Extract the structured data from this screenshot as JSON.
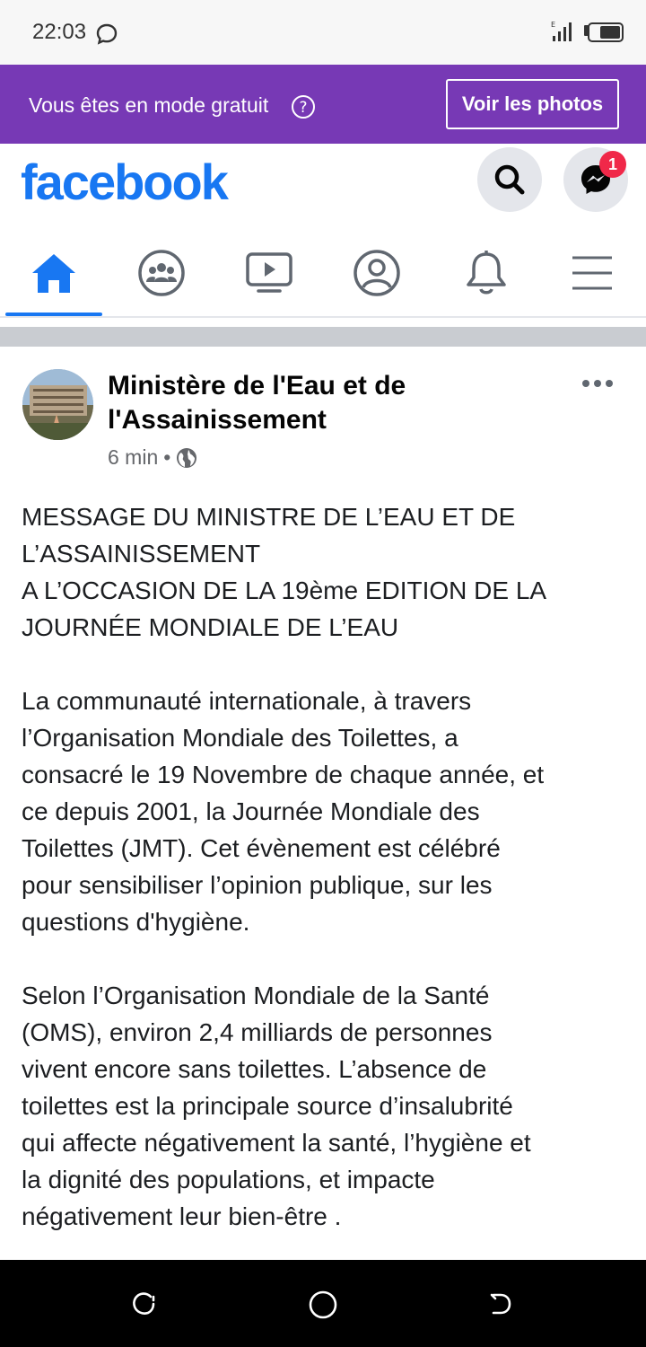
{
  "status_bar": {
    "time": "22:03"
  },
  "banner": {
    "free_mode_text": "Vous êtes en mode gratuit",
    "photos_button": "Voir les photos"
  },
  "header": {
    "logo": "facebook",
    "messenger_badge": "1"
  },
  "tabs": [
    {
      "icon": "home-icon",
      "active": true
    },
    {
      "icon": "groups-icon",
      "active": false
    },
    {
      "icon": "watch-icon",
      "active": false
    },
    {
      "icon": "profile-icon",
      "active": false
    },
    {
      "icon": "bell-icon",
      "active": false
    },
    {
      "icon": "menu-icon",
      "active": false
    }
  ],
  "post": {
    "author": "Ministère de l'Eau et de l'Assainissement",
    "time": "6 min",
    "separator": "•",
    "lines": [
      "MESSAGE DU MINISTRE DE L’EAU ET DE",
      "L’ASSAINISSEMENT",
      "A L’OCCASION DE LA 19ème EDITION DE LA",
      "JOURNÉE MONDIALE DE L’EAU",
      "",
      "La communauté internationale, à travers",
      "l’Organisation Mondiale des Toilettes, a",
      "consacré le 19 Novembre de chaque année, et",
      "ce depuis 2001, la Journée Mondiale des",
      "Toilettes (JMT). Cet évènement est célébré",
      "pour sensibiliser l’opinion publique, sur les",
      "questions d'hygiène.",
      "",
      "Selon l’Organisation Mondiale de la Santé",
      "(OMS), environ 2,4 milliards de personnes",
      "vivent encore sans toilettes. L’absence de",
      "toilettes est la principale source d’insalubrité",
      "qui affecte négativement la santé, l’hygiène et",
      "la dignité des populations, et impacte",
      "négativement leur bien-être ."
    ]
  },
  "colors": {
    "brand": "#1877f2",
    "banner": "#7739b5",
    "badge": "#f02849"
  }
}
